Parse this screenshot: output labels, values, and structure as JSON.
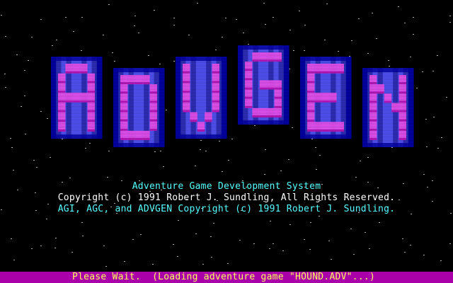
{
  "screen": {
    "background_color": "#000000",
    "star_color": "#AAAAAA"
  },
  "logo": {
    "letters": [
      "A",
      "D",
      "V",
      "G",
      "E",
      "N"
    ],
    "colors": {
      "base": "#3030C0",
      "light": "#5555FF",
      "dark": "#0000AA",
      "glyph": "#FF55FF",
      "shade": "#AA00AA"
    }
  },
  "credits": {
    "title": "Adventure Game Development System",
    "copyright": "Copyright (c) 1991 Robert J. Sundling, All Rights Reserved.",
    "tools": "AGI, AGC, and ADVGEN Copyright (c) 1991 Robert J. Sundling.",
    "title_color": "#55FFFF",
    "copyright_color": "#FFFFFF",
    "tools_color": "#55FFFF"
  },
  "status_bar": {
    "message": "Please Wait.  (Loading adventure game \"HOUND.ADV\"...)",
    "background_color": "#AA00AA",
    "text_color": "#FFFF55"
  }
}
